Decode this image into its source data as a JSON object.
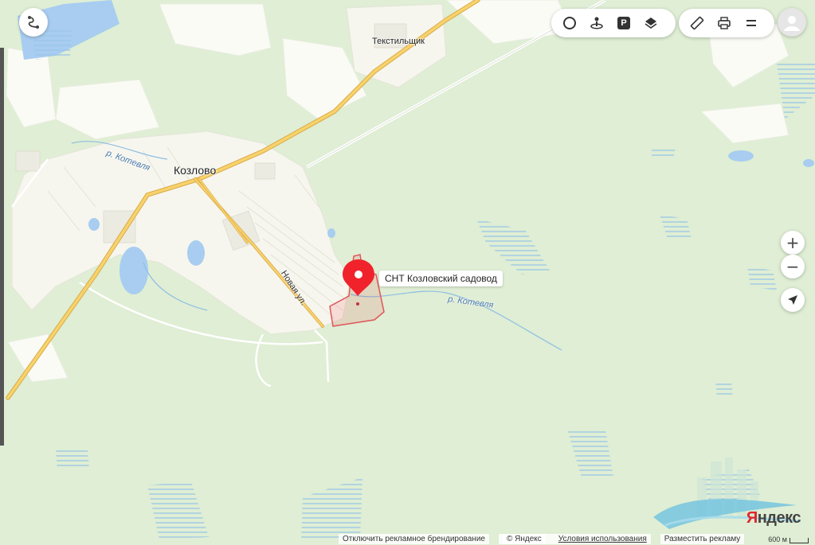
{
  "map": {
    "places": {
      "tekstilshchik": "Текстильщик",
      "kozlovo": "Козлово"
    },
    "river_labels": [
      "р. Котевля",
      "р. Котевля"
    ],
    "street_label": "Новая ул.",
    "pin": {
      "label": "СНТ Козловский садовод",
      "color": "#f0232d"
    }
  },
  "controls": {
    "top_left": {
      "icon": "route-icon"
    },
    "top_group_1": [
      "traffic-icon",
      "panorama-icon",
      "parking-icon",
      "layers-icon"
    ],
    "parking_glyph": "P",
    "top_group_2": [
      "ruler-icon",
      "print-icon",
      "menu-icon"
    ],
    "avatar": "avatar-icon",
    "zoom_in": "+",
    "zoom_out": "−",
    "locate": "locate-icon"
  },
  "footer": {
    "disable_branding": "Отключить рекламное брендирование",
    "copyright": "© Яндекс",
    "terms": "Условия использования",
    "advertise": "Разместить рекламу",
    "scale": "600 м"
  },
  "logo": {
    "first": "Я",
    "rest": "ндекс"
  },
  "colors": {
    "forest": "#dfeed4",
    "field": "#fbfbf6",
    "water": "#a8cdf0",
    "road": "#f7d36b",
    "accent": "#f0232d"
  }
}
